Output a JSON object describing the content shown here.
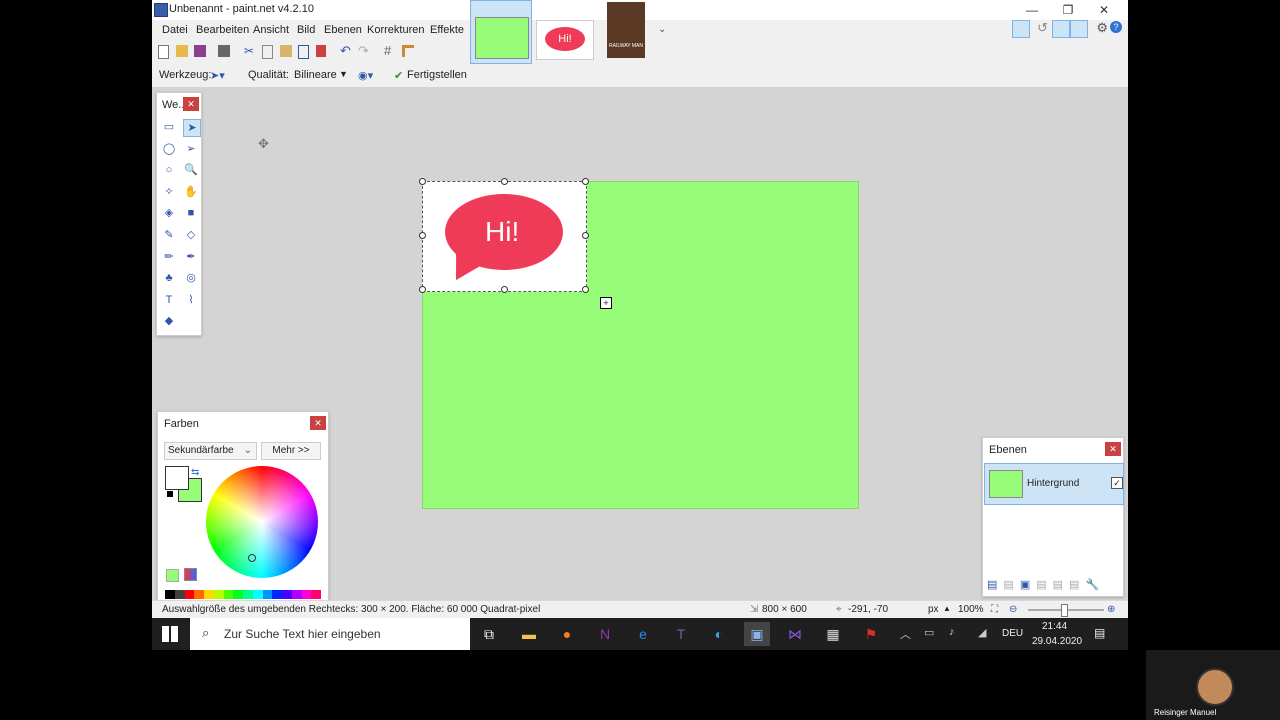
{
  "app": {
    "title": "Unbenannt - paint.net v4.2.10",
    "menu": [
      "Datei",
      "Bearbeiten",
      "Ansicht",
      "Bild",
      "Ebenen",
      "Korrekturen",
      "Effekte"
    ],
    "toolbar_icons": [
      "new-icon",
      "open-icon",
      "save-icon",
      "print-icon",
      "cut-icon",
      "copy-icon",
      "paste-icon",
      "crop-icon",
      "deselect-icon",
      "undo-icon",
      "redo-icon",
      "grid-icon",
      "ruler-icon"
    ]
  },
  "tool_options": {
    "tool_label": "Werkzeug:",
    "quality_label": "Qualität:",
    "quality_value": "Bilineare",
    "finish_label": "Fertigstellen"
  },
  "tabs": {
    "thumb2_text": "Hi!",
    "thumb3_text": "RAILWAY MAN"
  },
  "canvas": {
    "bubble_text": "Hi!",
    "image_color": "#97fc77",
    "bubble_color": "#ef3a58"
  },
  "tools_panel": {
    "title": "We...",
    "tools": [
      {
        "name": "rectangle-select-icon",
        "glyph": "▭"
      },
      {
        "name": "move-selected-icon",
        "glyph": "➤"
      },
      {
        "name": "lasso-select-icon",
        "glyph": "◯"
      },
      {
        "name": "move-selection-icon",
        "glyph": "➢"
      },
      {
        "name": "ellipse-select-icon",
        "glyph": "○"
      },
      {
        "name": "zoom-icon",
        "glyph": "🔍"
      },
      {
        "name": "magic-wand-icon",
        "glyph": "✧"
      },
      {
        "name": "pan-icon",
        "glyph": "✋"
      },
      {
        "name": "paint-bucket-icon",
        "glyph": "◈"
      },
      {
        "name": "gradient-icon",
        "glyph": "■"
      },
      {
        "name": "paintbrush-icon",
        "glyph": "✎"
      },
      {
        "name": "eraser-icon",
        "glyph": "◇"
      },
      {
        "name": "pencil-icon",
        "glyph": "✏"
      },
      {
        "name": "color-picker-icon",
        "glyph": "✒"
      },
      {
        "name": "clone-stamp-icon",
        "glyph": "♣"
      },
      {
        "name": "recolor-icon",
        "glyph": "◎"
      },
      {
        "name": "text-icon",
        "glyph": "T"
      },
      {
        "name": "line-curve-icon",
        "glyph": "⌇"
      },
      {
        "name": "shapes-icon",
        "glyph": "◆"
      }
    ]
  },
  "colors_panel": {
    "title": "Farben",
    "select_value": "Sekundärfarbe",
    "more_button": "Mehr >>",
    "primary_color": "#ffffff",
    "secondary_color": "#97fc77",
    "palette": [
      "#000000",
      "#404040",
      "#ff0000",
      "#ff6a00",
      "#ffd800",
      "#b6ff00",
      "#4cff00",
      "#00ff21",
      "#00ff90",
      "#00ffff",
      "#0094ff",
      "#0026ff",
      "#4800ff",
      "#b200ff",
      "#ff00dc",
      "#ff006e"
    ]
  },
  "layers_panel": {
    "title": "Ebenen",
    "layers": [
      {
        "name": "Hintergrund",
        "visible": true
      }
    ]
  },
  "status": {
    "hint": "Auswahlgröße des umgebenden Rechtecks: 300 × 200. Fläche: 60 000 Quadrat-pixel",
    "image_size": "800 × 600",
    "cursor_pos": "-291, -70",
    "unit": "px",
    "zoom": "100%"
  },
  "taskbar": {
    "search_placeholder": "Zur Suche Text hier eingeben",
    "language": "DEU",
    "time": "21:44",
    "date": "29.04.2020",
    "apps": [
      "task-view-icon",
      "explorer-icon",
      "firefox-icon",
      "onenote-icon",
      "edge-icon",
      "teams-icon",
      "app-icon",
      "paintnet-icon",
      "visual-studio-icon",
      "calculator-icon",
      "acrobat-icon"
    ]
  },
  "webcam": {
    "name": "Reisinger Manuel"
  }
}
